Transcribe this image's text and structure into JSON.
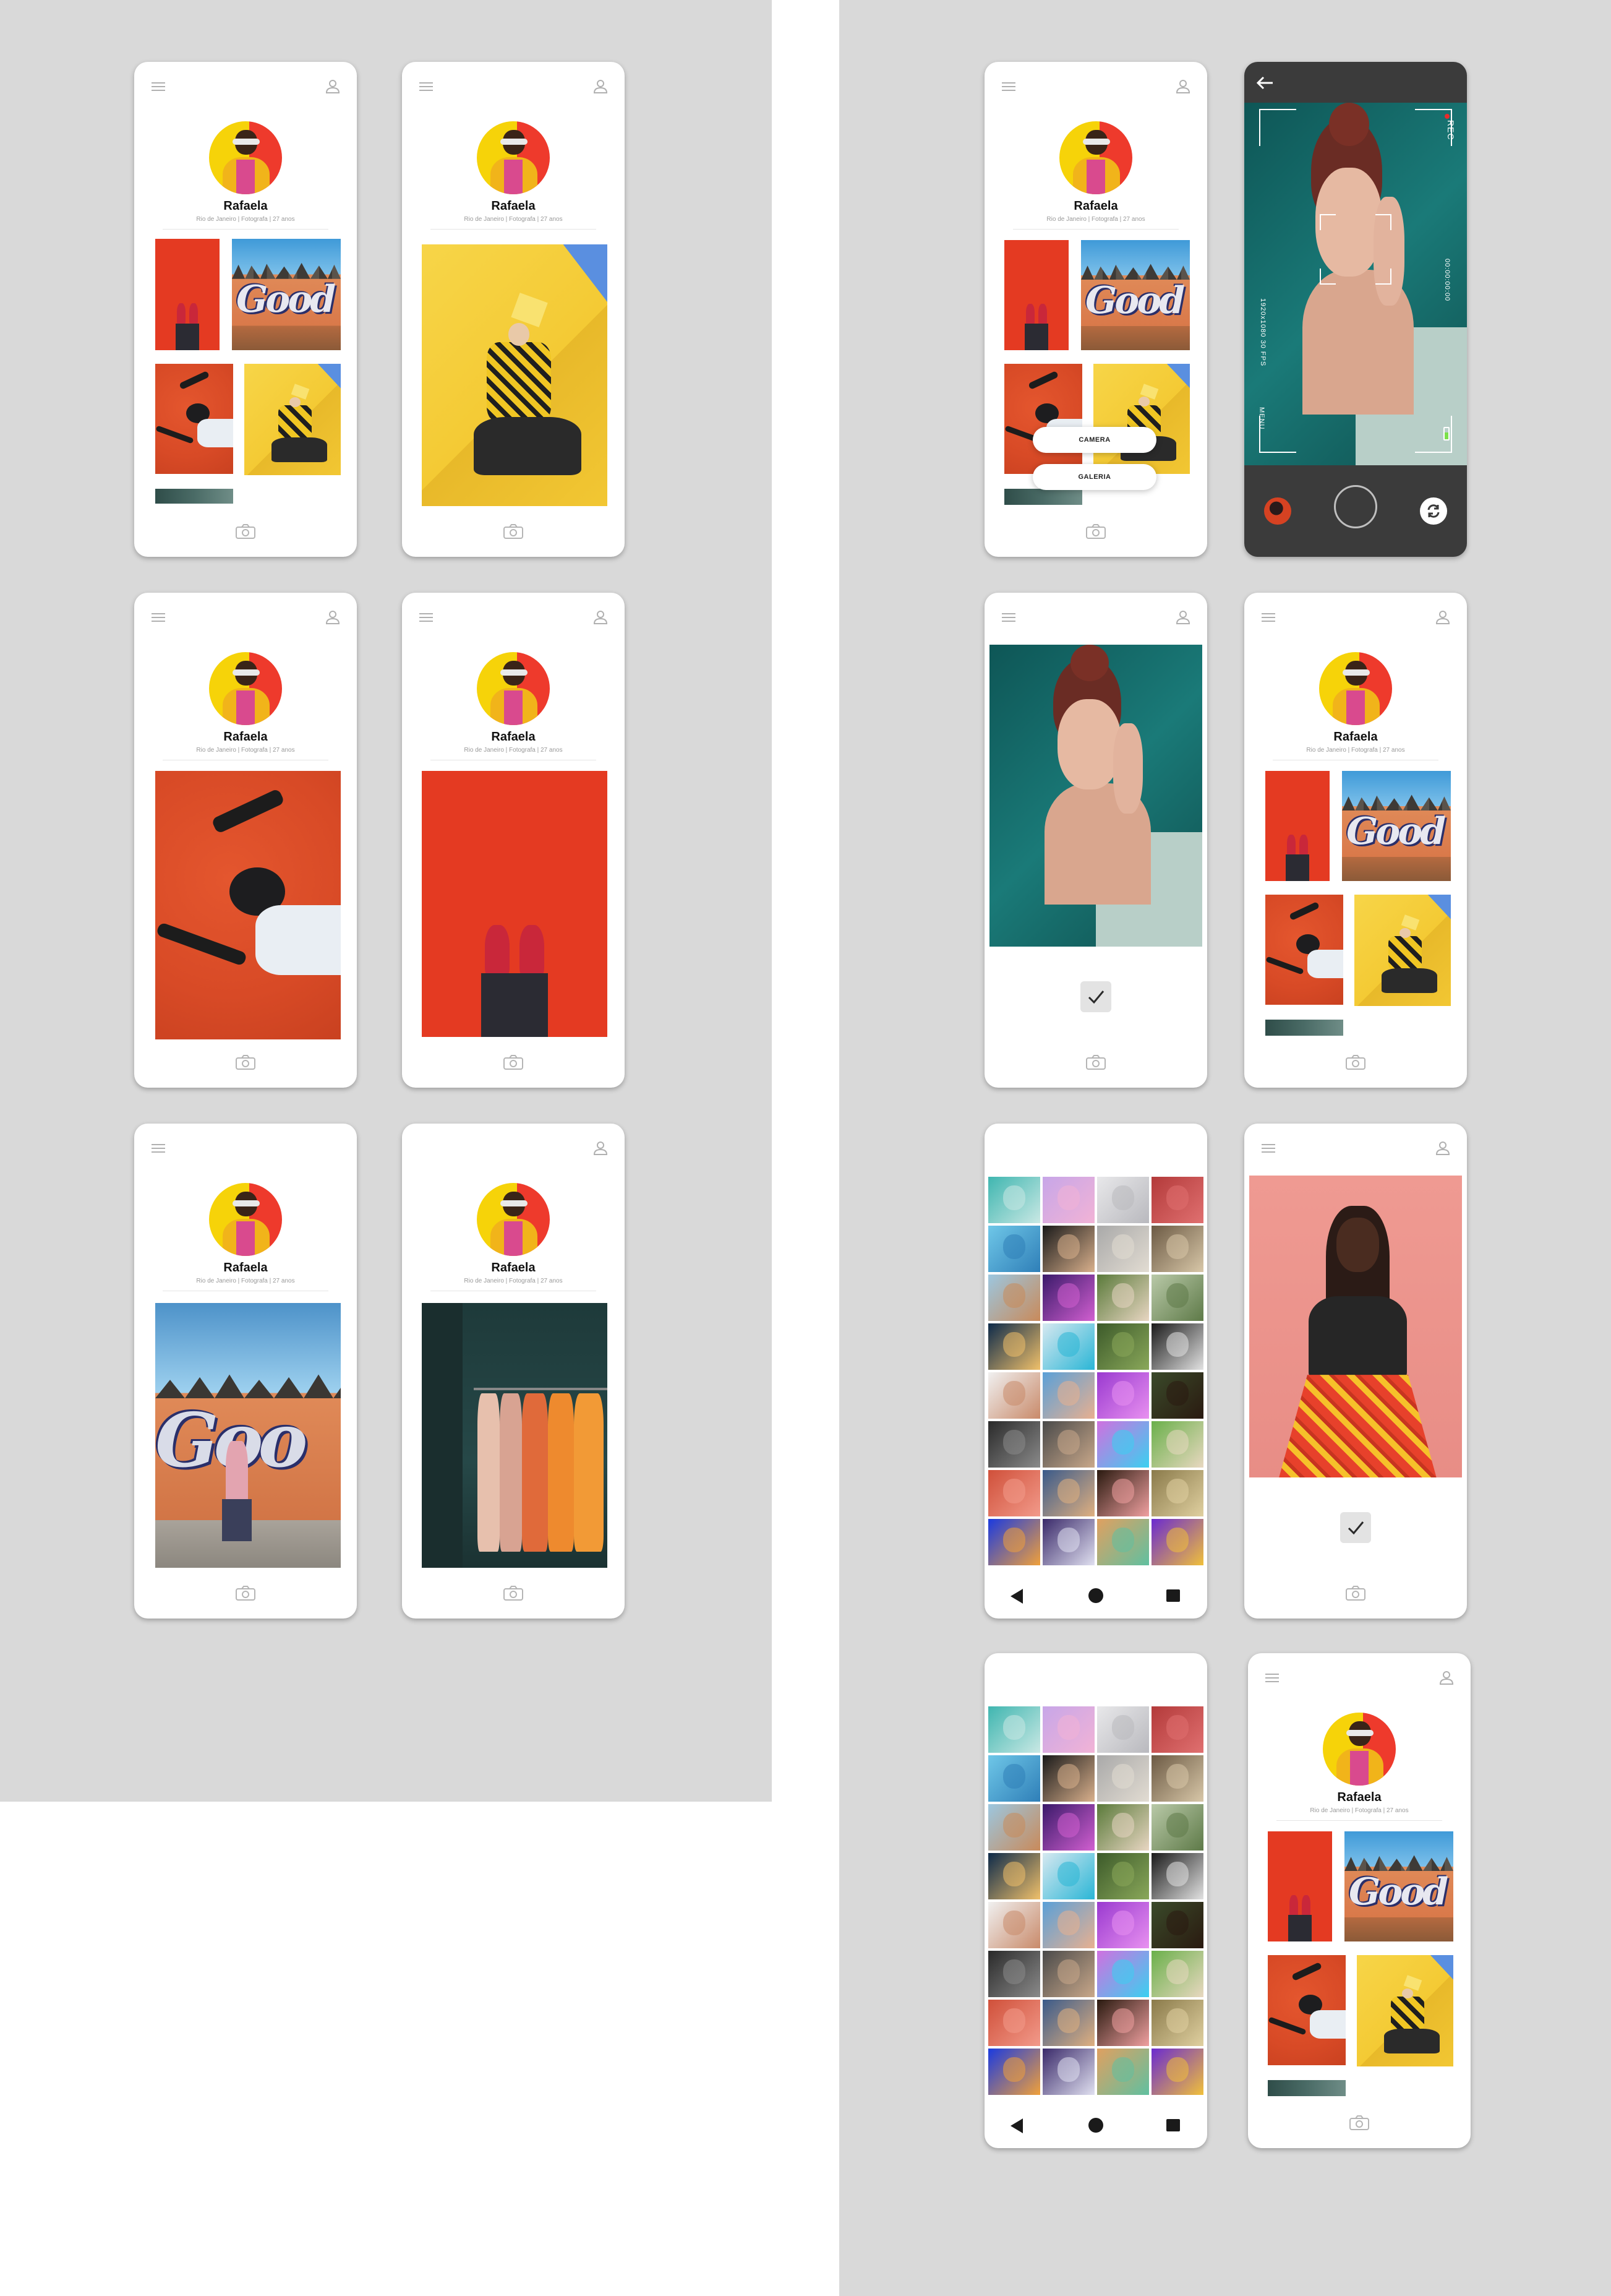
{
  "profile": {
    "name": "Rafaela",
    "meta": "Rio de Janeiro | Fotografa  |  27 anos"
  },
  "popup": {
    "camera": "CAMERA",
    "galeria": "GALERIA"
  },
  "camera_view": {
    "rec": "REC",
    "resolution": "1920x1080 30 FPS",
    "timecode": "00:00:00:00",
    "mode": "MENU"
  },
  "colors": {
    "panel_bg": "#d9d9d9",
    "accent_yellow": "#f6d309",
    "accent_red": "#ee3a2c",
    "camera_bg": "#3b3b3b"
  },
  "icons": [
    "menu-icon",
    "user-icon",
    "camera-icon",
    "check-icon",
    "back-arrow-icon",
    "switch-camera-icon",
    "nav-back-icon",
    "nav-home-icon",
    "nav-recent-icon"
  ]
}
